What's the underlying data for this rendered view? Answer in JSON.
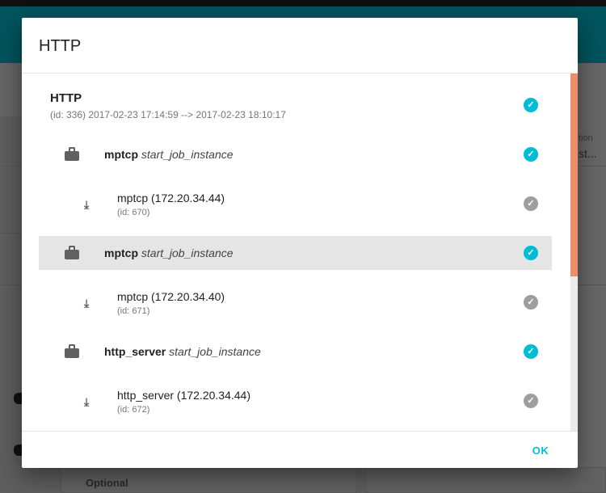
{
  "background": {
    "right_label": "tion",
    "right_value": "st...",
    "optional_label": "Optional"
  },
  "dialog": {
    "title": "HTTP",
    "ok_label": "OK",
    "root": {
      "name": "HTTP",
      "subtitle": "(id: 336) 2017-02-23 17:14:59 --> 2017-02-23 18:10:17",
      "status_icon": "check-circle-icon"
    },
    "jobs": [
      {
        "name": "mptcp",
        "action": "start_job_instance",
        "instance": {
          "title": "mptcp (172.20.34.44)",
          "id": "(id: 670)"
        }
      },
      {
        "name": "mptcp",
        "action": "start_job_instance",
        "instance": {
          "title": "mptcp (172.20.34.40)",
          "id": "(id: 671)"
        }
      },
      {
        "name": "http_server",
        "action": "start_job_instance",
        "instance": {
          "title": "http_server (172.20.34.44)",
          "id": "(id: 672)"
        }
      }
    ]
  },
  "colors": {
    "accent": "#00bcd4",
    "done": "#9e9e9e",
    "scrollbar_thumb": "#eb8f68",
    "appbar": "#00545d"
  }
}
